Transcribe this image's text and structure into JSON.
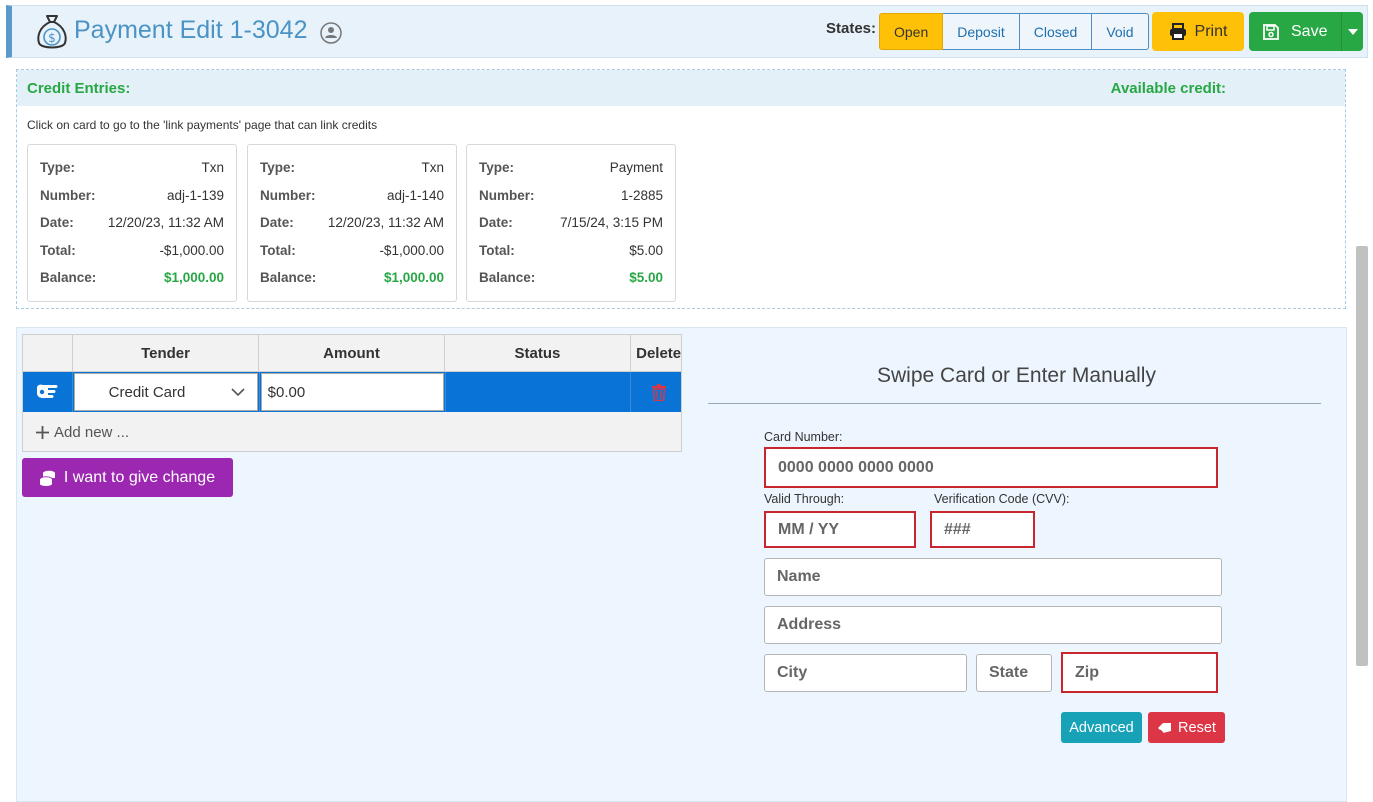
{
  "header": {
    "title": "Payment Edit 1-3042",
    "states_label": "States:",
    "states": [
      {
        "label": "Open",
        "active": true
      },
      {
        "label": "Deposit",
        "active": false
      },
      {
        "label": "Closed",
        "active": false
      },
      {
        "label": "Void",
        "active": false
      }
    ],
    "print_label": "Print",
    "save_label": "Save",
    "title_icon": "money-bag-icon",
    "info_icon": "user-info-icon"
  },
  "credit": {
    "title": "Credit Entries:",
    "available_label": "Available credit:",
    "hint": "Click on card to go to the 'link payments' page that can link credits",
    "labels": {
      "type": "Type:",
      "number": "Number:",
      "date": "Date:",
      "total": "Total:",
      "balance": "Balance:"
    },
    "cards": [
      {
        "type": "Txn",
        "number": "adj-1-139",
        "date": "12/20/23, 11:32 AM",
        "total": "-$1,000.00",
        "balance": "$1,000.00"
      },
      {
        "type": "Txn",
        "number": "adj-1-140",
        "date": "12/20/23, 11:32 AM",
        "total": "-$1,000.00",
        "balance": "$1,000.00"
      },
      {
        "type": "Payment",
        "number": "1-2885",
        "date": "7/15/24, 3:15 PM",
        "total": "$5.00",
        "balance": "$5.00"
      }
    ]
  },
  "tenders": {
    "headers": {
      "tender": "Tender",
      "amount": "Amount",
      "status": "Status",
      "delete": "Delete"
    },
    "rows": [
      {
        "tender": "Credit Card",
        "amount": "$0.00",
        "status": ""
      }
    ],
    "add_new": "Add new ...",
    "change_button": "I want to give change"
  },
  "card_form": {
    "title": "Swipe Card or Enter Manually",
    "card_number_label": "Card Number:",
    "card_number_placeholder": "0000 0000 0000 0000",
    "valid_through_label": "Valid Through:",
    "valid_through_placeholder": "MM / YY",
    "cvv_label": "Verification Code (CVV):",
    "cvv_placeholder": "###",
    "name_placeholder": "Name",
    "address_placeholder": "Address",
    "city_placeholder": "City",
    "state_placeholder": "State",
    "zip_placeholder": "Zip",
    "advanced_label": "Advanced",
    "reset_label": "Reset"
  },
  "colors": {
    "accent_blue": "#4a93c4",
    "open_state": "#ffc107",
    "print": "#ffc107",
    "save": "#28a745",
    "credit_green": "#28a745",
    "selected_row": "#0a74d6",
    "change_button": "#9c27b0",
    "advanced": "#17a2b8",
    "reset": "#dc3545",
    "error_border": "#c9252c"
  }
}
